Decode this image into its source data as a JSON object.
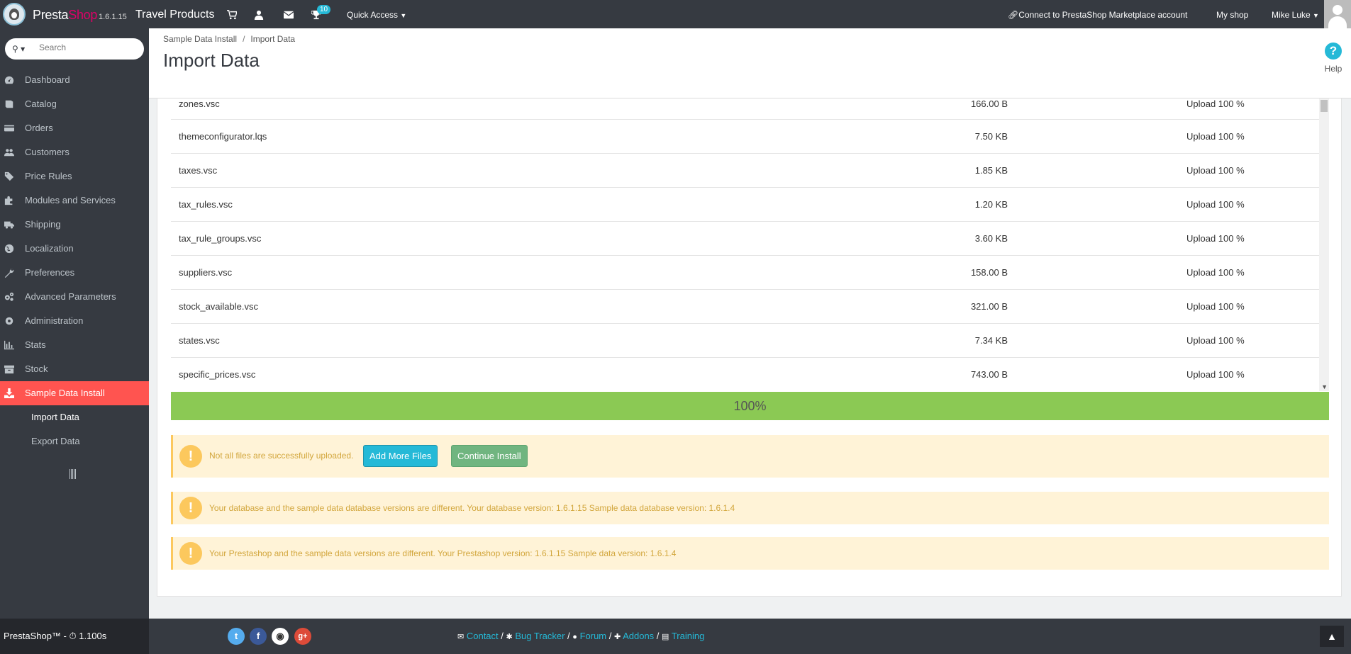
{
  "topbar": {
    "brand_presta": "Presta",
    "brand_shop": "Shop",
    "version": "1.6.1.15",
    "shop_name": "Travel Products",
    "notification_count": "10",
    "quick_access": "Quick Access",
    "marketplace": "Connect to PrestaShop Marketplace account",
    "my_shop": "My shop",
    "user": "Mike Luke"
  },
  "sidebar": {
    "search_placeholder": "Search",
    "items": [
      {
        "label": "Dashboard",
        "icon": "dashboard-icon"
      },
      {
        "label": "Catalog",
        "icon": "book-icon"
      },
      {
        "label": "Orders",
        "icon": "credit-card-icon"
      },
      {
        "label": "Customers",
        "icon": "users-icon"
      },
      {
        "label": "Price Rules",
        "icon": "tags-icon"
      },
      {
        "label": "Modules and Services",
        "icon": "puzzle-icon"
      },
      {
        "label": "Shipping",
        "icon": "truck-icon"
      },
      {
        "label": "Localization",
        "icon": "globe-icon"
      },
      {
        "label": "Preferences",
        "icon": "wrench-icon"
      },
      {
        "label": "Advanced Parameters",
        "icon": "cogs-icon"
      },
      {
        "label": "Administration",
        "icon": "cog-icon"
      },
      {
        "label": "Stats",
        "icon": "bar-chart-icon"
      },
      {
        "label": "Stock",
        "icon": "archive-icon"
      },
      {
        "label": "Sample Data Install",
        "icon": "download-icon"
      }
    ],
    "subitems": [
      {
        "label": "Import Data"
      },
      {
        "label": "Export Data"
      }
    ]
  },
  "header": {
    "breadcrumb_parent": "Sample Data Install",
    "breadcrumb_current": "Import Data",
    "title": "Import Data",
    "help": "Help"
  },
  "files": [
    {
      "name": "zones.vsc",
      "size": "166.00 B",
      "status": "Upload 100 %"
    },
    {
      "name": "themeconfigurator.lqs",
      "size": "7.50 KB",
      "status": "Upload 100 %"
    },
    {
      "name": "taxes.vsc",
      "size": "1.85 KB",
      "status": "Upload 100 %"
    },
    {
      "name": "tax_rules.vsc",
      "size": "1.20 KB",
      "status": "Upload 100 %"
    },
    {
      "name": "tax_rule_groups.vsc",
      "size": "3.60 KB",
      "status": "Upload 100 %"
    },
    {
      "name": "suppliers.vsc",
      "size": "158.00 B",
      "status": "Upload 100 %"
    },
    {
      "name": "stock_available.vsc",
      "size": "321.00 B",
      "status": "Upload 100 %"
    },
    {
      "name": "states.vsc",
      "size": "7.34 KB",
      "status": "Upload 100 %"
    },
    {
      "name": "specific_prices.vsc",
      "size": "743.00 B",
      "status": "Upload 100 %"
    }
  ],
  "progress": {
    "label": "100%",
    "value": 1.0
  },
  "alerts": {
    "upload_warning": "Not all files are successfully uploaded.",
    "add_more_button": "Add More Files",
    "continue_button": "Continue Install",
    "db_version_warning": "Your database and the sample data database versions are different. Your database version: 1.6.1.15 Sample data database version: 1.6.1.4",
    "ps_version_warning": "Your Prestashop and the sample data versions are different. Your Prestashop version: 1.6.1.15 Sample data version: 1.6.1.4"
  },
  "footer": {
    "left_text": "PrestaShop™ - ⏱ 1.100s",
    "links": {
      "contact": "Contact",
      "bug_tracker": "Bug Tracker",
      "forum": "Forum",
      "addons": "Addons",
      "training": "Training"
    },
    "social": {
      "twitter": "t",
      "facebook": "f",
      "google": "g+"
    }
  },
  "colors": {
    "accent": "#25b9d7",
    "active_menu": "#ff5450",
    "progress": "#8bc954",
    "alert_bg": "#fff3d7",
    "alert_icon": "#fcc85d"
  }
}
